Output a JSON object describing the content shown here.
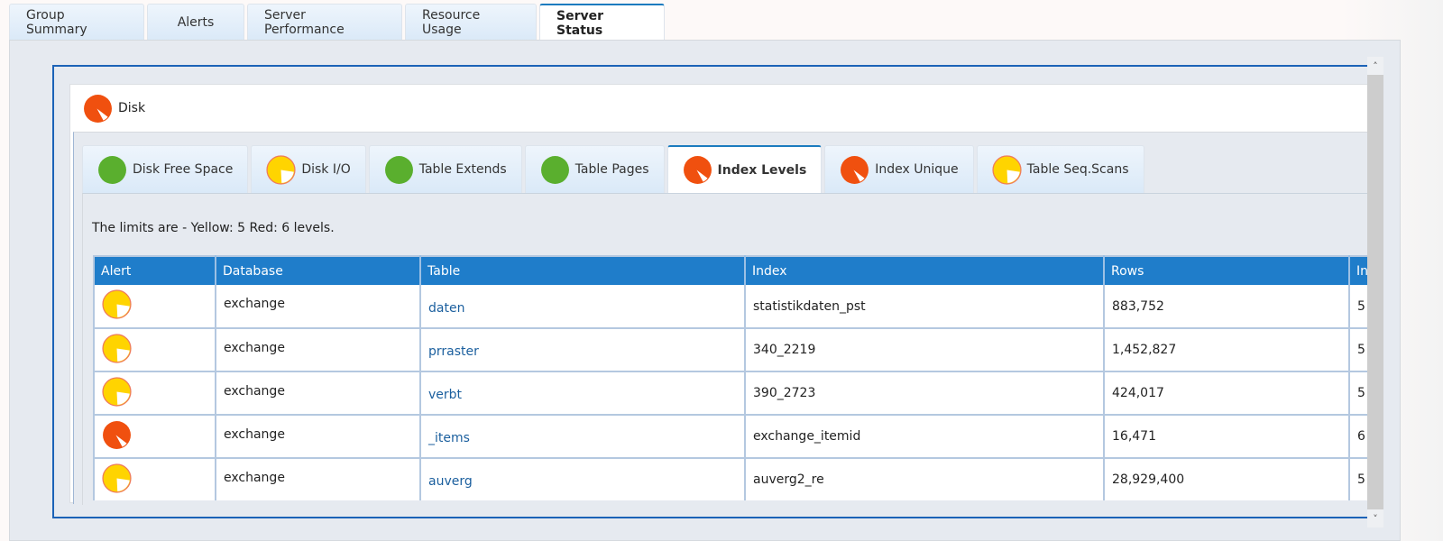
{
  "top_tabs": [
    {
      "label": "Group Summary",
      "active": false
    },
    {
      "label": "Alerts",
      "active": false
    },
    {
      "label": "Server Performance",
      "active": false
    },
    {
      "label": "Resource Usage",
      "active": false
    },
    {
      "label": "Server Status",
      "active": true
    }
  ],
  "disk_panel": {
    "title": "Disk",
    "status_icon": "red-alert-pie-icon"
  },
  "sub_tabs": [
    {
      "label": "Disk Free Space",
      "status": "green",
      "active": false
    },
    {
      "label": "Disk I/O",
      "status": "yellow",
      "active": false
    },
    {
      "label": "Table Extends",
      "status": "green",
      "active": false
    },
    {
      "label": "Table Pages",
      "status": "green",
      "active": false
    },
    {
      "label": "Index Levels",
      "status": "red",
      "active": true
    },
    {
      "label": "Index Unique",
      "status": "red",
      "active": false
    },
    {
      "label": "Table Seq.Scans",
      "status": "yellow",
      "active": false
    }
  ],
  "limits_text": "The limits are - Yellow: 5 Red: 6 levels.",
  "table": {
    "columns": [
      "Alert",
      "Database",
      "Table",
      "Index",
      "Rows",
      "In"
    ],
    "rows": [
      {
        "alert": "yellow",
        "database": "exchange",
        "table": "daten",
        "index": "statistikdaten_pst",
        "rows": "883,752",
        "levels": "5"
      },
      {
        "alert": "yellow",
        "database": "exchange",
        "table": "prraster",
        "index": "340_2219",
        "rows": "1,452,827",
        "levels": "5"
      },
      {
        "alert": "yellow",
        "database": "exchange",
        "table": "verbt",
        "index": "390_2723",
        "rows": "424,017",
        "levels": "5"
      },
      {
        "alert": "red",
        "database": "exchange",
        "table": "_items",
        "index": "exchange_itemid",
        "rows": "16,471",
        "levels": "6"
      },
      {
        "alert": "yellow",
        "database": "exchange",
        "table": "auverg",
        "index": "auverg2_re",
        "rows": "28,929,400",
        "levels": "5"
      }
    ]
  },
  "colors": {
    "green": "#5aaf2e",
    "yellow": "#ffd400",
    "red": "#f0500f",
    "header_blue": "#1f7dca",
    "frame_blue": "#1c63b7",
    "link_blue": "#1b5f9e"
  }
}
